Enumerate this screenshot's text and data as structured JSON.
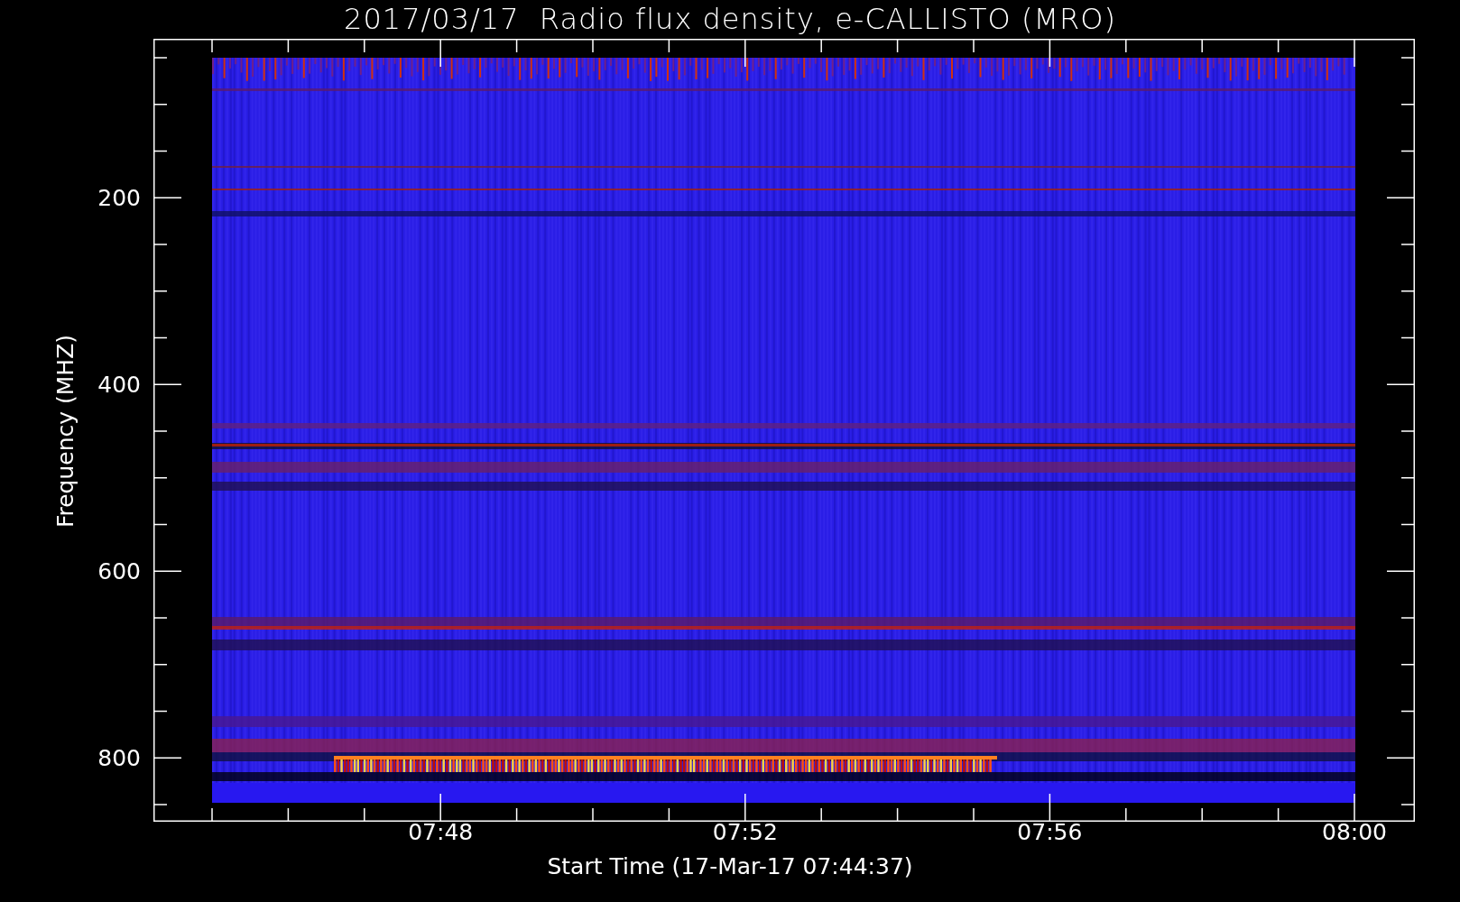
{
  "title": "2017/03/17  Radio flux density, e-CALLISTO (MRO)",
  "y_axis": {
    "label": "Frequency (MHZ)",
    "ticks": [
      "200",
      "400",
      "600",
      "800"
    ]
  },
  "x_axis": {
    "label": "Start Time (17-Mar-17 07:44:37)",
    "ticks": [
      "07:48",
      "07:52",
      "07:56",
      "08:00"
    ]
  }
}
